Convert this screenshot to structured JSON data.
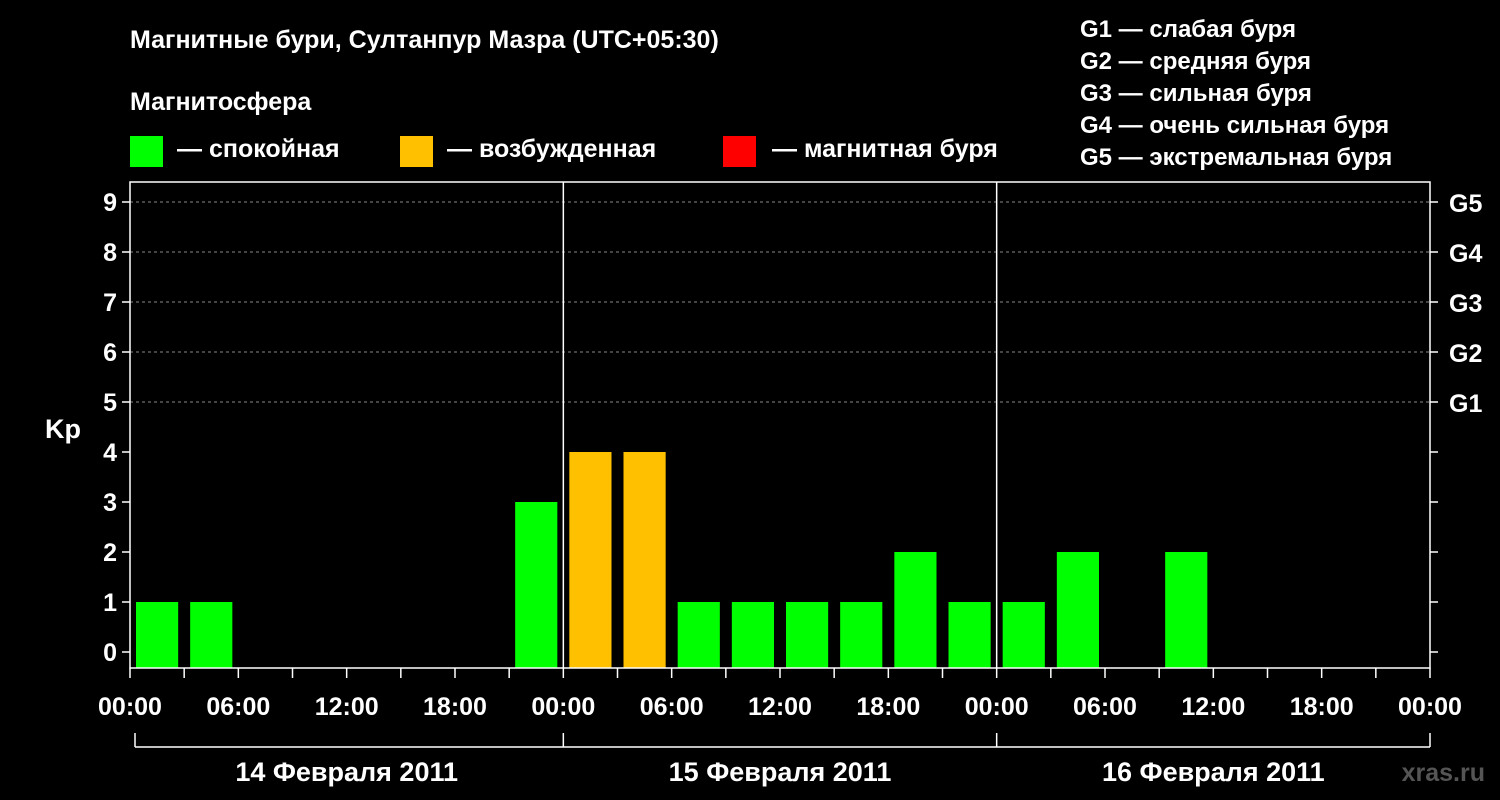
{
  "title": "Магнитные бури, Султанпур Мазра (UTC+05:30)",
  "legend": {
    "heading": "Магнитосфера",
    "items": [
      {
        "label": "— спокойная",
        "color": "#00ff00"
      },
      {
        "label": "— возбужденная",
        "color": "#ffc000"
      },
      {
        "label": "— магнитная буря",
        "color": "#ff0000"
      }
    ]
  },
  "g_scale": [
    {
      "label": "G1 — слабая буря",
      "kp": 5,
      "tick": "G1"
    },
    {
      "label": "G2 — средняя буря",
      "kp": 6,
      "tick": "G2"
    },
    {
      "label": "G3 — сильная буря",
      "kp": 7,
      "tick": "G3"
    },
    {
      "label": "G4 — очень сильная буря",
      "kp": 8,
      "tick": "G4"
    },
    {
      "label": "G5 — экстремальная буря",
      "kp": 9,
      "tick": "G5"
    }
  ],
  "watermark": "xras.ru",
  "chart_data": {
    "type": "bar",
    "ylabel": "Kp",
    "ylim": [
      0,
      9
    ],
    "y_ticks": [
      0,
      1,
      2,
      3,
      4,
      5,
      6,
      7,
      8,
      9
    ],
    "x_tick_labels": [
      "00:00",
      "06:00",
      "12:00",
      "18:00",
      "00:00",
      "06:00",
      "12:00",
      "18:00",
      "00:00",
      "06:00",
      "12:00",
      "18:00",
      "00:00"
    ],
    "days": [
      "14 Февраля 2011",
      "15 Февраля 2011",
      "16 Февраля 2011"
    ],
    "bars": [
      {
        "day": "14 Февраля 2011",
        "start": "00:00",
        "end": "03:00",
        "kp": 1,
        "status": "спокойная"
      },
      {
        "day": "14 Февраля 2011",
        "start": "03:00",
        "end": "06:00",
        "kp": 1,
        "status": "спокойная"
      },
      {
        "day": "14 Февраля 2011",
        "start": "21:00",
        "end": "24:00",
        "kp": 3,
        "status": "спокойная"
      },
      {
        "day": "15 Февраля 2011",
        "start": "00:00",
        "end": "03:00",
        "kp": 4,
        "status": "возбужденная"
      },
      {
        "day": "15 Февраля 2011",
        "start": "03:00",
        "end": "06:00",
        "kp": 4,
        "status": "возбужденная"
      },
      {
        "day": "15 Февраля 2011",
        "start": "06:00",
        "end": "09:00",
        "kp": 1,
        "status": "спокойная"
      },
      {
        "day": "15 Февраля 2011",
        "start": "09:00",
        "end": "12:00",
        "kp": 1,
        "status": "спокойная"
      },
      {
        "day": "15 Февраля 2011",
        "start": "12:00",
        "end": "15:00",
        "kp": 1,
        "status": "спокойная"
      },
      {
        "day": "15 Февраля 2011",
        "start": "15:00",
        "end": "18:00",
        "kp": 1,
        "status": "спокойная"
      },
      {
        "day": "15 Февраля 2011",
        "start": "18:00",
        "end": "21:00",
        "kp": 2,
        "status": "спокойная"
      },
      {
        "day": "15 Февраля 2011",
        "start": "21:00",
        "end": "24:00",
        "kp": 1,
        "status": "спокойная"
      },
      {
        "day": "16 Февраля 2011",
        "start": "00:00",
        "end": "03:00",
        "kp": 1,
        "status": "спокойная"
      },
      {
        "day": "16 Февраля 2011",
        "start": "03:00",
        "end": "06:00",
        "kp": 2,
        "status": "спокойная"
      },
      {
        "day": "16 Февраля 2011",
        "start": "09:00",
        "end": "12:00",
        "kp": 2,
        "status": "спокойная"
      }
    ],
    "grid": true
  }
}
